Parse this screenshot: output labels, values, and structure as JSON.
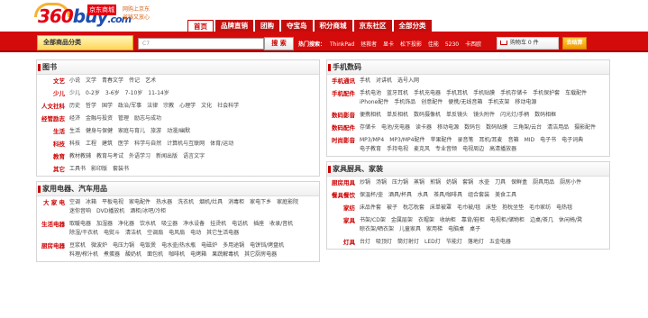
{
  "logo": {
    "text_a": "360",
    "text_b": "buy",
    "suffix": ".com",
    "cn": "京东商城"
  },
  "slogan": [
    "网购上京东",
    "省钱又放心"
  ],
  "nav": [
    "首页",
    "品牌直销",
    "团购",
    "夺宝岛",
    "积分商城",
    "京东社区",
    "全部分类"
  ],
  "all_categories": "全部商品分类",
  "search": {
    "placeholder": "C7",
    "button": "搜 索"
  },
  "hot": {
    "label": "热门搜索：",
    "terms": [
      "ThinkPad",
      "拯救者",
      "显卡",
      "松下投影",
      "佳能",
      "5230",
      "卡西欧"
    ]
  },
  "cart": {
    "label": "购物车 0 件"
  },
  "checkout": "去结算",
  "left": [
    {
      "title": "图书",
      "rows": [
        {
          "label": "文艺",
          "items": [
            "小说",
            "文学",
            "青春文学",
            "传记",
            "艺术"
          ]
        },
        {
          "label": "少儿",
          "items": [
            "少儿",
            "0-2岁",
            "3-6岁",
            "7-10岁",
            "11-14岁"
          ]
        },
        {
          "label": "人文社科",
          "items": [
            "历史",
            "哲学",
            "国学",
            "政治/军事",
            "法律",
            "宗教",
            "心理学",
            "文化",
            "社会科学"
          ]
        },
        {
          "label": "经管励志",
          "items": [
            "经济",
            "金融与投资",
            "管理",
            "励志与成功"
          ]
        },
        {
          "label": "生活",
          "items": [
            "生活",
            "健身与保健",
            "家庭与育儿",
            "旅游",
            "动漫/幽默"
          ]
        },
        {
          "label": "科技",
          "items": [
            "科技",
            "工程",
            "建筑",
            "医学",
            "科学与自然",
            "计算机与互联网",
            "体育/运动"
          ]
        },
        {
          "label": "教育",
          "items": [
            "教材教辅",
            "教育与考试",
            "外语学习",
            "新闻出版",
            "语言文字"
          ]
        },
        {
          "label": "其它",
          "items": [
            "工具书",
            "影印版",
            "套装书"
          ]
        }
      ]
    },
    {
      "title": "家用电器、汽车用品",
      "rows": [
        {
          "label": "大 家 电",
          "items": [
            "空调",
            "冰箱",
            "平板电视",
            "家电配件",
            "热水器",
            "洗衣机",
            "烟机/灶具",
            "消毒柜",
            "家电下乡",
            "家庭影院",
            "迷你音响",
            "DVD播放机",
            "酒柜/冰吧/冷柜"
          ]
        },
        {
          "label": "生活电器",
          "items": [
            "取暖电器",
            "加湿器",
            "净化器",
            "饮水机",
            "吸尘器",
            "净水设备",
            "挂烫机",
            "电话机",
            "插座",
            "收录/音机",
            "除湿/干衣机",
            "电熨斗",
            "清洁机",
            "空调扇",
            "电风扇",
            "电动",
            "其它生活电器"
          ]
        },
        {
          "label": "厨房电器",
          "items": [
            "豆浆机",
            "微波炉",
            "电压力锅",
            "电饭煲",
            "电水壶/热水瓶",
            "电磁炉",
            "多用途锅",
            "电饼铛/烤盘机",
            "料理/榨汁机",
            "煮蛋器",
            "酸奶机",
            "面包机",
            "咖啡机",
            "电烤箱",
            "果蔬解毒机",
            "其它厨房电器"
          ]
        }
      ]
    }
  ],
  "right": [
    {
      "title": "手机数码",
      "rows": [
        {
          "label": "手机通讯",
          "items": [
            "手机",
            "对讲机",
            "选号入网"
          ]
        },
        {
          "label": "手机配件",
          "items": [
            "手机电池",
            "蓝牙耳机",
            "手机充电器",
            "手机耳机",
            "手机贴膜",
            "手机存储卡",
            "手机保护套",
            "车载配件",
            "iPhone配件",
            "手机饰品",
            "创意配件",
            "便携/无线音箱",
            "手机支架",
            "移动电源"
          ]
        },
        {
          "label": "数码影音",
          "items": [
            "便携相机",
            "单反相机",
            "数码摄像机",
            "单反镜头",
            "镜头附件",
            "闪光灯/手柄",
            "数码相框"
          ]
        },
        {
          "label": "数码配件",
          "items": [
            "存储卡",
            "电池/充电器",
            "读卡器",
            "移动电源",
            "数码包",
            "数码贴膜",
            "三角架/云台",
            "清洁用品",
            "摄影配件"
          ]
        },
        {
          "label": "时尚影音",
          "items": [
            "MP3/MP4",
            "MP3/MP4配件",
            "苹果配件",
            "录音笔",
            "耳机/耳麦",
            "音箱",
            "MID",
            "电子书",
            "电子词典",
            "电子教育",
            "手持电视",
            "麦克风",
            "专业音频",
            "电视周边",
            "高清播放器"
          ]
        }
      ]
    },
    {
      "title": "家具厨具、家装",
      "rows": [
        {
          "label": "厨房用具",
          "items": [
            "炒锅",
            "汤锅",
            "压力锅",
            "蒸锅",
            "煎锅",
            "奶锅",
            "套锅",
            "水壶",
            "刀具",
            "保鲜盒",
            "厨具用品",
            "厨房小件"
          ]
        },
        {
          "label": "餐具餐饮",
          "items": [
            "保温杯/壶",
            "酒具/杯具",
            "水具",
            "茶具/咖啡具",
            "组合套装",
            "美食工具"
          ]
        },
        {
          "label": "家纺",
          "items": [
            "床品件套",
            "被子",
            "枕芯枕套",
            "床单被罩",
            "毛巾被/毯",
            "床垫",
            "抱枕坐垫",
            "毛巾家纺",
            "电热毯"
          ]
        },
        {
          "label": "家具",
          "items": [
            "书架/CD架",
            "金属层架",
            "衣帽架",
            "收纳柜",
            "靠背/鞋柜",
            "电视柜/储物柜",
            "边桌/茶几",
            "休闲椅/凳",
            "晾衣架/晒衣架",
            "儿童家具",
            "家用梯",
            "电脑桌",
            "桌子"
          ]
        },
        {
          "label": "灯具",
          "items": [
            "台灯",
            "吸顶灯",
            "筒灯射灯",
            "LED灯",
            "节能灯",
            "落地灯",
            "五金电器"
          ]
        }
      ]
    }
  ],
  "colors": {
    "brand_red": "#d40b0b",
    "nav_red": "#c30d0d",
    "label_red": "#cc0000"
  }
}
